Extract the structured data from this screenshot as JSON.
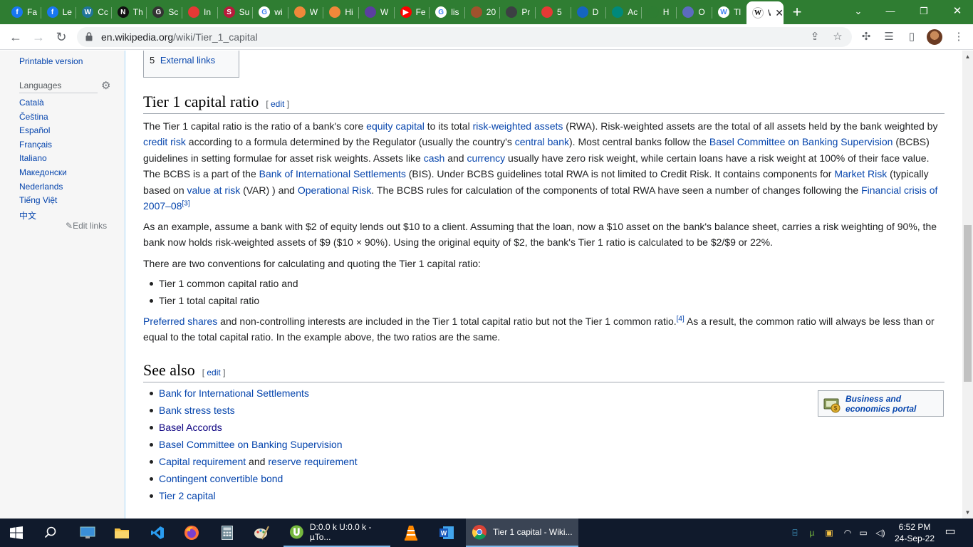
{
  "browser": {
    "tabs": [
      {
        "label": "Fa",
        "favicon": "facebook-icon",
        "color": "#1877f2",
        "glyph": "f"
      },
      {
        "label": "Le",
        "favicon": "facebook-icon",
        "color": "#1877f2",
        "glyph": "f"
      },
      {
        "label": "Cc",
        "favicon": "wordpress-icon",
        "color": "#21759b",
        "glyph": "W"
      },
      {
        "label": "Th",
        "favicon": "notion-icon",
        "color": "#111111",
        "glyph": "N"
      },
      {
        "label": "Sc",
        "favicon": "grammarly-icon",
        "color": "#333333",
        "glyph": "G"
      },
      {
        "label": "In",
        "favicon": "red-square-icon",
        "color": "#e53935",
        "glyph": ""
      },
      {
        "label": "Su",
        "favicon": "s-icon",
        "color": "#b71c3c",
        "glyph": "S"
      },
      {
        "label": "wi",
        "favicon": "google-icon",
        "color": "#ffffff",
        "glyph": "G"
      },
      {
        "label": "W",
        "favicon": "cloud-icon",
        "color": "#f0883a",
        "glyph": ""
      },
      {
        "label": "Hi",
        "favicon": "cloud-icon",
        "color": "#f0883a",
        "glyph": ""
      },
      {
        "label": "W",
        "favicon": "purple-grid-icon",
        "color": "#5b3fa0",
        "glyph": ""
      },
      {
        "label": "Fe",
        "favicon": "youtube-icon",
        "color": "#ff0000",
        "glyph": "▶"
      },
      {
        "label": "lis",
        "favicon": "google-icon",
        "color": "#ffffff",
        "glyph": "G"
      },
      {
        "label": "20",
        "favicon": "circle-icon",
        "color": "#a0522d",
        "glyph": ""
      },
      {
        "label": "Pr",
        "favicon": "chrome-store-icon",
        "color": "#3c4043",
        "glyph": ""
      },
      {
        "label": "5",
        "favicon": "tomato-icon",
        "color": "#e53935",
        "glyph": ""
      },
      {
        "label": "D",
        "favicon": "globe-icon",
        "color": "#1565c0",
        "glyph": ""
      },
      {
        "label": "Ac",
        "favicon": "shield-icon",
        "color": "#00897b",
        "glyph": ""
      },
      {
        "label": "H",
        "favicon": "spiral-icon",
        "color": "#2e7d32",
        "glyph": ""
      },
      {
        "label": "O",
        "favicon": "half-circle-icon",
        "color": "#5c6bc0",
        "glyph": ""
      },
      {
        "label": "Tl",
        "favicon": "wikipedia-icon",
        "color": "#ffffff",
        "glyph": "W"
      }
    ],
    "active_tab": {
      "label": "W",
      "favicon": "wikipedia-icon"
    },
    "url_domain": "en.wikipedia.org",
    "url_path": "/wiki/Tier_1_capital"
  },
  "sidebar": {
    "printable": "Printable version",
    "languages_heading": "Languages",
    "languages": [
      "Català",
      "Čeština",
      "Español",
      "Français",
      "Italiano",
      "Македонски",
      "Nederlands",
      "Tiếng Việt",
      "中文"
    ],
    "edit_links": "Edit links"
  },
  "toc": {
    "number": "5",
    "label": "External links"
  },
  "ratio_section": {
    "heading": "Tier 1 capital ratio",
    "edit": "edit",
    "conventions_intro": "There are two conventions for calculating and quoting the Tier 1 capital ratio:",
    "conventions": [
      "Tier 1 common capital ratio and",
      "Tier 1 total capital ratio"
    ],
    "links": {
      "equity_capital": "equity capital",
      "risk_weighted_assets": "risk-weighted assets",
      "credit_risk": "credit risk",
      "central_bank": "central bank",
      "basel_committee": "Basel Committee on Banking Supervision",
      "cash": "cash",
      "currency": "currency",
      "bis": "Bank of International Settlements",
      "market_risk": "Market Risk",
      "value_at_risk": "value at risk",
      "operational_risk": "Operational Risk",
      "financial_crisis": "Financial crisis of 2007–08",
      "preferred_shares": "Preferred shares"
    },
    "text": {
      "p1a": "The Tier 1 capital ratio is the ratio of a bank's core ",
      "p1b": " to its total ",
      "p1c": " (RWA). Risk-weighted assets are the total of all assets held by the bank weighted by ",
      "p1d": " according to a formula determined by the Regulator (usually the country's ",
      "p1e": "). Most central banks follow the ",
      "p1f": " (BCBS) guidelines in setting formulae for asset risk weights. Assets like ",
      "p1g": " and ",
      "p1h": " usually have zero risk weight, while certain loans have a risk weight at 100% of their face value. The BCBS is a part of the ",
      "p1i": " (BIS). Under BCBS guidelines total RWA is not limited to Credit Risk. It contains components for ",
      "p1j": " (typically based on ",
      "p1k": " (VAR) ) and ",
      "p1l": ". The BCBS rules for calculation of the components of total RWA have seen a number of changes following the ",
      "ref3": "[3]",
      "p2": "As an example, assume a bank with $2 of equity lends out $10 to a client. Assuming that the loan, now a $10 asset on the bank's balance sheet, carries a risk weighting of 90%, the bank now holds risk-weighted assets of $9 ($10 × 90%). Using the original equity of $2, the bank's Tier 1 ratio is calculated to be $2/$9 or 22%.",
      "p4a": " and non-controlling interests are included in the Tier 1 total capital ratio but not the Tier 1 common ratio.",
      "ref4": "[4]",
      "p4b": " As a result, the common ratio will always be less than or equal to the total capital ratio. In the example above, the two ratios are the same."
    }
  },
  "see_also": {
    "heading": "See also",
    "edit": "edit",
    "items": [
      {
        "text": "Bank for International Settlements",
        "link": true
      },
      {
        "text": "Bank stress tests",
        "link": true
      },
      {
        "text": "Basel Accords",
        "link": false,
        "color": "#0b0080"
      },
      {
        "text": "Basel Committee on Banking Supervision",
        "link": true
      },
      {
        "text": "Contingent convertible bond",
        "link": true
      },
      {
        "text": "Tier 2 capital",
        "link": true
      }
    ],
    "capital_req": "Capital requirement",
    "and": " and ",
    "reserve_req": "reserve requirement",
    "portal": "Business and economics portal"
  },
  "taskbar": {
    "utorrent_label": "D:0.0 k U:0.0 k - µTo...",
    "chrome_label": "Tier 1 capital - Wiki...",
    "time": "6:52 PM",
    "date": "24-Sep-22"
  },
  "colors": {
    "link": "#0645ad",
    "tabstrip": "#2f7d32",
    "taskbar": "#101a2c"
  }
}
